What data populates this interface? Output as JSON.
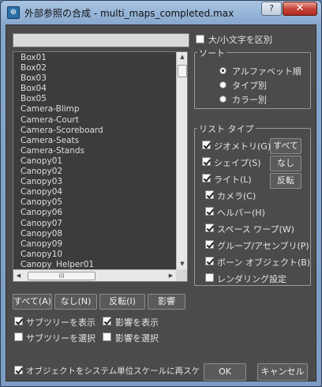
{
  "window": {
    "title": "外部参照の合成 - multi_maps_completed.max",
    "help_label": "?",
    "close_label": "✕"
  },
  "search": {
    "value": "",
    "placeholder": ""
  },
  "object_list": {
    "items": [
      "Box01",
      "Box02",
      "Box03",
      "Box04",
      "Box05",
      "Camera-Blimp",
      "Camera-Court",
      "Camera-Scoreboard",
      "Camera-Seats",
      "Camera-Stands",
      "Canopy01",
      "Canopy02",
      "Canopy03",
      "Canopy04",
      "Canopy05",
      "Canopy06",
      "Canopy07",
      "Canopy08",
      "Canopy09",
      "Canopy10",
      "Canopy_Helper01"
    ],
    "hscroll_thumb": "III"
  },
  "case_sensitive": {
    "label": "大/小文字を区別",
    "checked": false
  },
  "sort": {
    "title": "ソート",
    "options": [
      {
        "label": "アルファベット順",
        "selected": true
      },
      {
        "label": "タイプ別",
        "selected": false
      },
      {
        "label": "カラー別",
        "selected": false
      }
    ]
  },
  "list_types": {
    "title": "リスト タイプ",
    "items": [
      {
        "label": "ジオメトリ(G)",
        "checked": true
      },
      {
        "label": "シェイプ(S)",
        "checked": true
      },
      {
        "label": "ライト(L)",
        "checked": true
      },
      {
        "label": "カメラ(C)",
        "checked": true
      },
      {
        "label": "ヘルパー(H)",
        "checked": true
      },
      {
        "label": "スペース ワープ(W)",
        "checked": true
      },
      {
        "label": "グループ/アセンブリ(P)",
        "checked": true
      },
      {
        "label": "ボーン オブジェクト(B)",
        "checked": true
      },
      {
        "label": "レンダリング設定",
        "checked": false
      }
    ],
    "all_button": "すべて",
    "none_button": "なし",
    "invert_button": "反転"
  },
  "list_buttons": {
    "all": "すべて(A)",
    "none": "なし(N)",
    "invert": "反転(I)",
    "influences": "影響"
  },
  "options": {
    "display_subtree": {
      "label": "サブツリーを表示",
      "checked": true
    },
    "display_influences": {
      "label": "影響を表示",
      "checked": true
    },
    "select_subtree": {
      "label": "サブツリーを選択",
      "checked": false
    },
    "select_influences": {
      "label": "影響を選択",
      "checked": false
    },
    "rescale": {
      "label": "オブジェクトをシステム単位スケールに再スケ",
      "checked": true
    }
  },
  "footer": {
    "ok": "OK",
    "cancel": "キャンセル"
  }
}
